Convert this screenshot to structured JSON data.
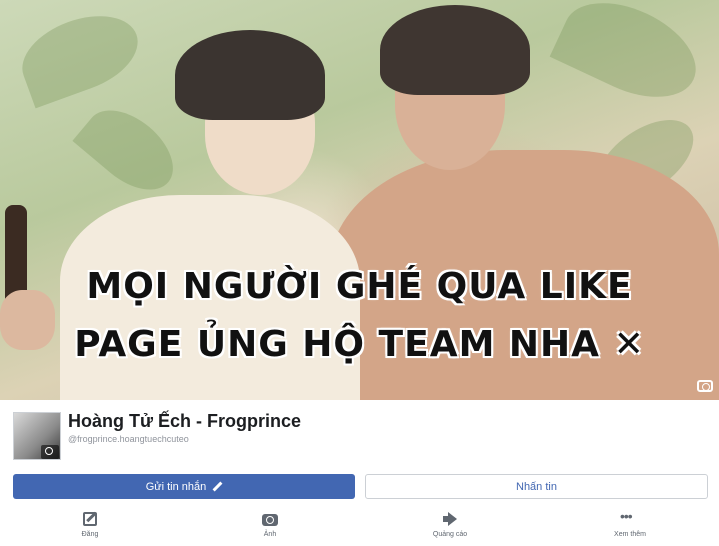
{
  "cover": {
    "caption_line1": "MỌI NGƯỜI GHÉ QUA LIKE",
    "caption_line2": "PAGE ỦNG HỘ TEAM NHA ✕",
    "camera_icon": "camera-icon"
  },
  "profile": {
    "name": "Hoàng Tử Ếch - Frogprince",
    "handle": "@frogprince.hoangtuechcuteo",
    "avatar_icon": "camera-icon"
  },
  "buttons": {
    "message_label": "Gửi tin nhắn",
    "message_icon": "pencil-icon",
    "like_label": "Nhấn tin"
  },
  "actions": [
    {
      "label": "Đăng",
      "icon": "edit-icon"
    },
    {
      "label": "Ảnh",
      "icon": "camera-icon"
    },
    {
      "label": "Quảng cáo",
      "icon": "megaphone-icon"
    },
    {
      "label": "Xem thêm",
      "icon": "more-dots-icon"
    }
  ],
  "colors": {
    "primary": "#4267b2",
    "text_secondary": "#606770",
    "border": "#ccd0d5"
  }
}
